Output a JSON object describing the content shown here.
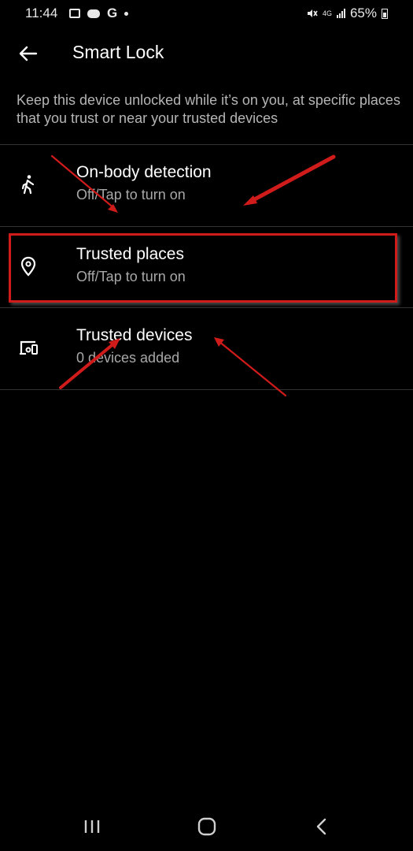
{
  "status_bar": {
    "time": "11:44",
    "network_type": "4G",
    "battery_percent": "65%",
    "left_icons": [
      "gallery-icon",
      "game-icon",
      "google-g-icon",
      "notification-dot-icon"
    ],
    "right_icons": [
      "mute-icon",
      "network-4g-icon",
      "signal-icon",
      "battery-icon"
    ],
    "google_letter": "G"
  },
  "header": {
    "title": "Smart Lock"
  },
  "description": "Keep this device unlocked while it’s on you, at specific places that you trust or near your trusted devices",
  "items": [
    {
      "title": "On-body detection",
      "subtitle": "Off/Tap to turn on",
      "icon": "walking-person-icon"
    },
    {
      "title": "Trusted places",
      "subtitle": "Off/Tap to turn on",
      "icon": "location-pin-icon"
    },
    {
      "title": "Trusted devices",
      "subtitle": "0 devices added",
      "icon": "devices-icon"
    }
  ],
  "nav_bar": {
    "buttons": [
      "recents-icon",
      "home-icon",
      "back-icon"
    ]
  },
  "colors": {
    "background": "#000000",
    "annotation_red": "#d01b1b",
    "divider": "#333333",
    "secondary_text": "#a8a8a8"
  }
}
